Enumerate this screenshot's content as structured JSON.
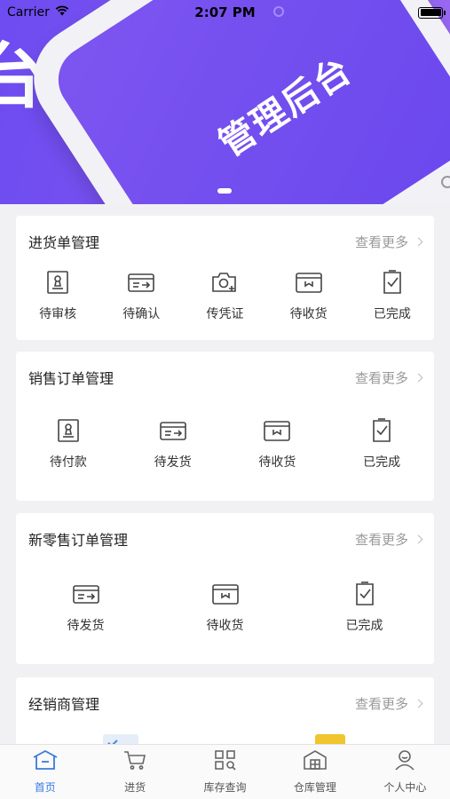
{
  "status_bar": {
    "carrier": "Carrier",
    "time": "2:07 PM"
  },
  "banner": {
    "overlay_char": "台",
    "screen_text": "管理后台"
  },
  "purchase": {
    "title": "进货单管理",
    "more": "查看更多",
    "items": [
      {
        "label": "待审核",
        "icon": "audit-icon"
      },
      {
        "label": "待确认",
        "icon": "confirm-icon"
      },
      {
        "label": "传凭证",
        "icon": "upload-voucher-icon"
      },
      {
        "label": "待收货",
        "icon": "receive-icon"
      },
      {
        "label": "已完成",
        "icon": "completed-icon"
      }
    ]
  },
  "sales": {
    "title": "销售订单管理",
    "more": "查看更多",
    "items": [
      {
        "label": "待付款",
        "icon": "payment-icon"
      },
      {
        "label": "待发货",
        "icon": "ship-icon"
      },
      {
        "label": "待收货",
        "icon": "receive-icon"
      },
      {
        "label": "已完成",
        "icon": "completed-icon"
      }
    ]
  },
  "retail": {
    "title": "新零售订单管理",
    "more": "查看更多",
    "items": [
      {
        "label": "待发货",
        "icon": "ship-icon"
      },
      {
        "label": "待收货",
        "icon": "receive-icon"
      },
      {
        "label": "已完成",
        "icon": "completed-icon"
      }
    ]
  },
  "dealer": {
    "title": "经销商管理",
    "more": "查看更多"
  },
  "tabs": [
    {
      "label": "首页",
      "icon": "home-icon",
      "active": true
    },
    {
      "label": "进货",
      "icon": "cart-icon",
      "active": false
    },
    {
      "label": "库存查询",
      "icon": "inventory-search-icon",
      "active": false
    },
    {
      "label": "仓库管理",
      "icon": "warehouse-icon",
      "active": false
    },
    {
      "label": "个人中心",
      "icon": "profile-icon",
      "active": false
    }
  ],
  "colors": {
    "accent": "#3a7ae0",
    "banner_purple": "#7352f0"
  }
}
